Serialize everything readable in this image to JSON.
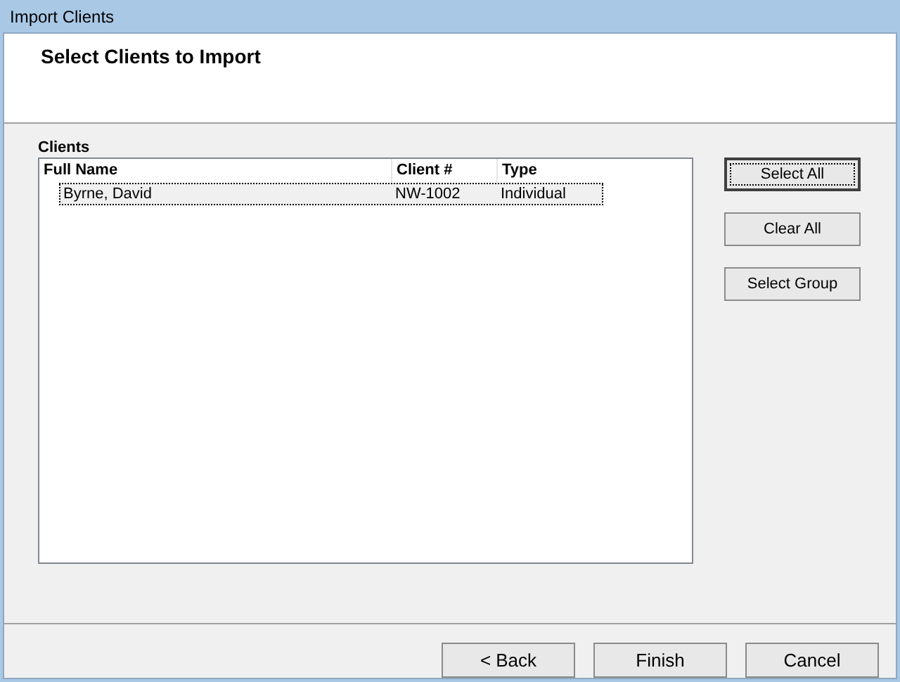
{
  "window": {
    "title": "Import Clients"
  },
  "header": {
    "title": "Select Clients to Import"
  },
  "clients": {
    "label": "Clients",
    "columns": [
      "Full Name",
      "Client #",
      "Type"
    ],
    "rows": [
      {
        "cells": [
          "Byrne, David",
          "NW-1002",
          "Individual"
        ],
        "selected": true
      }
    ]
  },
  "side_buttons": [
    {
      "label": "Select All",
      "default": true
    },
    {
      "label": "Clear All",
      "default": false
    },
    {
      "label": "Select Group",
      "default": false
    }
  ],
  "footer_buttons": [
    "< Back",
    "Finish",
    "Cancel"
  ]
}
